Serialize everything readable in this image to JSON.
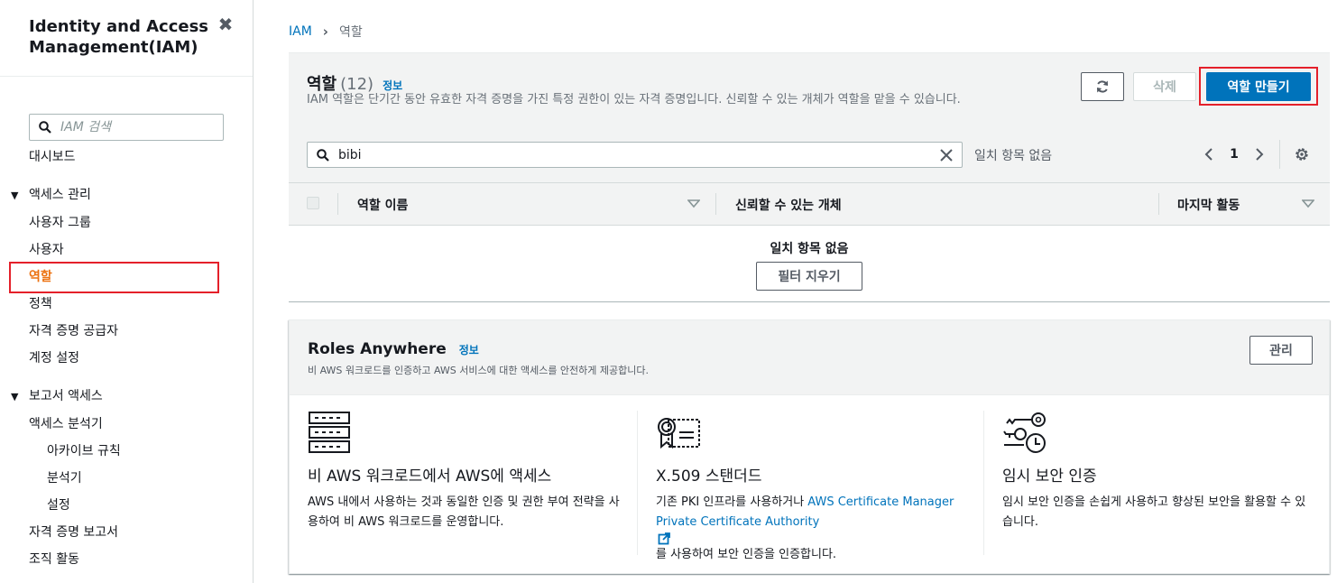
{
  "sidebar": {
    "title": "Identity and Access Management(IAM)",
    "search_placeholder": "IAM 검색",
    "dashboard": "대시보드",
    "access_mgmt": {
      "label": "액세스 관리",
      "items": [
        "사용자 그룹",
        "사용자",
        "역할",
        "정책",
        "자격 증명 공급자",
        "계정 설정"
      ]
    },
    "report_access": {
      "label": "보고서 액세스",
      "analyzer": "액세스 분석기",
      "sub_items": [
        "아카이브 규칙",
        "분석기",
        "설정"
      ],
      "items": [
        "자격 증명 보고서",
        "조직 활동"
      ]
    }
  },
  "breadcrumb": {
    "root": "IAM",
    "current": "역할"
  },
  "roles": {
    "title": "역할",
    "count": "(12)",
    "info": "정보",
    "description": "IAM 역할은 단기간 동안 유효한 자격 증명을 가진 특정 권한이 있는 자격 증명입니다. 신뢰할 수 있는 개체가 역할을 맡을 수 있습니다.",
    "delete_label": "삭제",
    "create_label": "역할 만들기",
    "filter_value": "bibi",
    "match_text": "일치 항목 없음",
    "page": "1",
    "columns": [
      "역할 이름",
      "신뢰할 수 있는 개체",
      "마지막 활동"
    ],
    "empty_text": "일치 항목 없음",
    "clear_filter": "필터 지우기"
  },
  "roles_anywhere": {
    "title": "Roles Anywhere",
    "info": "정보",
    "description": "비 AWS 워크로드를 인증하고 AWS 서비스에 대한 액세스를 안전하게 제공합니다.",
    "manage_label": "관리",
    "col1": {
      "title": "비 AWS 워크로드에서 AWS에 액세스",
      "text": "AWS 내에서 사용하는 것과 동일한 인증 및 권한 부여 전략을 사용하여 비 AWS 워크로드를 운영합니다."
    },
    "col2": {
      "title": "X.509 스탠더드",
      "text_before": "기존 PKI 인프라를 사용하거나 ",
      "link": "AWS Certificate Manager Private Certificate Authority",
      "text_after": " 를 사용하여 보안 인증을 인증합니다."
    },
    "col3": {
      "title": "임시 보안 인증",
      "text": "임시 보안 인증을 손쉽게 사용하고 향상된 보안을 활용할 수 있습니다."
    }
  },
  "colors": {
    "link": "#0073bb",
    "primary": "#0073bb",
    "active_nav": "#ec7211",
    "highlight": "#e4202a"
  },
  "icons": [
    "close-icon",
    "search-icon",
    "refresh-icon",
    "clear-icon",
    "chevron-left-icon",
    "chevron-right-icon",
    "gear-icon",
    "sort-icon",
    "server-icon",
    "certificate-icon",
    "keys-clock-icon",
    "external-link-icon"
  ]
}
